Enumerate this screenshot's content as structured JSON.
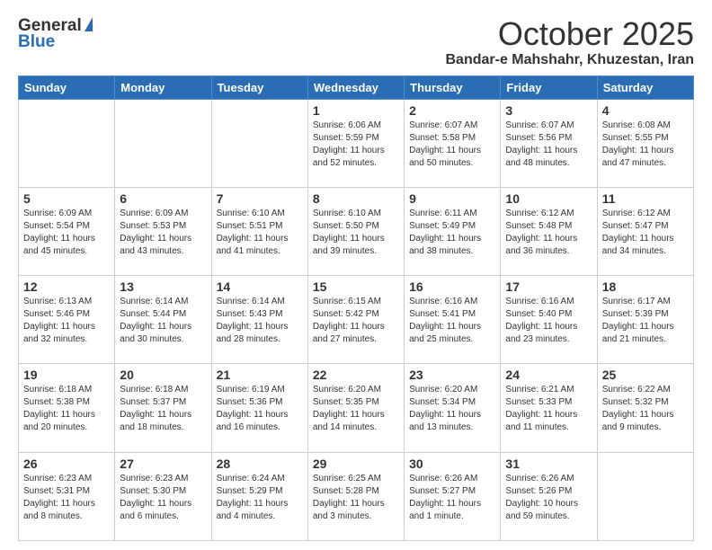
{
  "header": {
    "logo_general": "General",
    "logo_blue": "Blue",
    "month": "October 2025",
    "location": "Bandar-e Mahshahr, Khuzestan, Iran"
  },
  "weekdays": [
    "Sunday",
    "Monday",
    "Tuesday",
    "Wednesday",
    "Thursday",
    "Friday",
    "Saturday"
  ],
  "weeks": [
    [
      {
        "day": "",
        "info": ""
      },
      {
        "day": "",
        "info": ""
      },
      {
        "day": "",
        "info": ""
      },
      {
        "day": "1",
        "info": "Sunrise: 6:06 AM\nSunset: 5:59 PM\nDaylight: 11 hours and 52 minutes."
      },
      {
        "day": "2",
        "info": "Sunrise: 6:07 AM\nSunset: 5:58 PM\nDaylight: 11 hours and 50 minutes."
      },
      {
        "day": "3",
        "info": "Sunrise: 6:07 AM\nSunset: 5:56 PM\nDaylight: 11 hours and 48 minutes."
      },
      {
        "day": "4",
        "info": "Sunrise: 6:08 AM\nSunset: 5:55 PM\nDaylight: 11 hours and 47 minutes."
      }
    ],
    [
      {
        "day": "5",
        "info": "Sunrise: 6:09 AM\nSunset: 5:54 PM\nDaylight: 11 hours and 45 minutes."
      },
      {
        "day": "6",
        "info": "Sunrise: 6:09 AM\nSunset: 5:53 PM\nDaylight: 11 hours and 43 minutes."
      },
      {
        "day": "7",
        "info": "Sunrise: 6:10 AM\nSunset: 5:51 PM\nDaylight: 11 hours and 41 minutes."
      },
      {
        "day": "8",
        "info": "Sunrise: 6:10 AM\nSunset: 5:50 PM\nDaylight: 11 hours and 39 minutes."
      },
      {
        "day": "9",
        "info": "Sunrise: 6:11 AM\nSunset: 5:49 PM\nDaylight: 11 hours and 38 minutes."
      },
      {
        "day": "10",
        "info": "Sunrise: 6:12 AM\nSunset: 5:48 PM\nDaylight: 11 hours and 36 minutes."
      },
      {
        "day": "11",
        "info": "Sunrise: 6:12 AM\nSunset: 5:47 PM\nDaylight: 11 hours and 34 minutes."
      }
    ],
    [
      {
        "day": "12",
        "info": "Sunrise: 6:13 AM\nSunset: 5:46 PM\nDaylight: 11 hours and 32 minutes."
      },
      {
        "day": "13",
        "info": "Sunrise: 6:14 AM\nSunset: 5:44 PM\nDaylight: 11 hours and 30 minutes."
      },
      {
        "day": "14",
        "info": "Sunrise: 6:14 AM\nSunset: 5:43 PM\nDaylight: 11 hours and 28 minutes."
      },
      {
        "day": "15",
        "info": "Sunrise: 6:15 AM\nSunset: 5:42 PM\nDaylight: 11 hours and 27 minutes."
      },
      {
        "day": "16",
        "info": "Sunrise: 6:16 AM\nSunset: 5:41 PM\nDaylight: 11 hours and 25 minutes."
      },
      {
        "day": "17",
        "info": "Sunrise: 6:16 AM\nSunset: 5:40 PM\nDaylight: 11 hours and 23 minutes."
      },
      {
        "day": "18",
        "info": "Sunrise: 6:17 AM\nSunset: 5:39 PM\nDaylight: 11 hours and 21 minutes."
      }
    ],
    [
      {
        "day": "19",
        "info": "Sunrise: 6:18 AM\nSunset: 5:38 PM\nDaylight: 11 hours and 20 minutes."
      },
      {
        "day": "20",
        "info": "Sunrise: 6:18 AM\nSunset: 5:37 PM\nDaylight: 11 hours and 18 minutes."
      },
      {
        "day": "21",
        "info": "Sunrise: 6:19 AM\nSunset: 5:36 PM\nDaylight: 11 hours and 16 minutes."
      },
      {
        "day": "22",
        "info": "Sunrise: 6:20 AM\nSunset: 5:35 PM\nDaylight: 11 hours and 14 minutes."
      },
      {
        "day": "23",
        "info": "Sunrise: 6:20 AM\nSunset: 5:34 PM\nDaylight: 11 hours and 13 minutes."
      },
      {
        "day": "24",
        "info": "Sunrise: 6:21 AM\nSunset: 5:33 PM\nDaylight: 11 hours and 11 minutes."
      },
      {
        "day": "25",
        "info": "Sunrise: 6:22 AM\nSunset: 5:32 PM\nDaylight: 11 hours and 9 minutes."
      }
    ],
    [
      {
        "day": "26",
        "info": "Sunrise: 6:23 AM\nSunset: 5:31 PM\nDaylight: 11 hours and 8 minutes."
      },
      {
        "day": "27",
        "info": "Sunrise: 6:23 AM\nSunset: 5:30 PM\nDaylight: 11 hours and 6 minutes."
      },
      {
        "day": "28",
        "info": "Sunrise: 6:24 AM\nSunset: 5:29 PM\nDaylight: 11 hours and 4 minutes."
      },
      {
        "day": "29",
        "info": "Sunrise: 6:25 AM\nSunset: 5:28 PM\nDaylight: 11 hours and 3 minutes."
      },
      {
        "day": "30",
        "info": "Sunrise: 6:26 AM\nSunset: 5:27 PM\nDaylight: 11 hours and 1 minute."
      },
      {
        "day": "31",
        "info": "Sunrise: 6:26 AM\nSunset: 5:26 PM\nDaylight: 10 hours and 59 minutes."
      },
      {
        "day": "",
        "info": ""
      }
    ]
  ]
}
